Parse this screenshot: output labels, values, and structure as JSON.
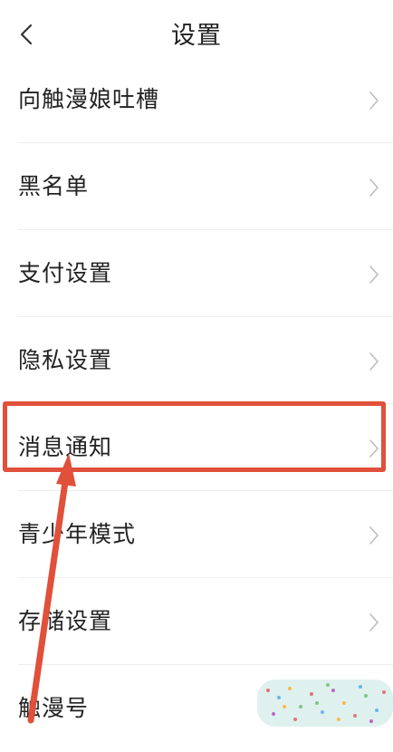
{
  "header": {
    "title": "设置"
  },
  "settings": {
    "items": [
      {
        "label": "向触漫娘吐槽"
      },
      {
        "label": "黑名单"
      },
      {
        "label": "支付设置"
      },
      {
        "label": "隐私设置"
      },
      {
        "label": "消息通知"
      },
      {
        "label": "青少年模式"
      },
      {
        "label": "存储设置"
      },
      {
        "label": "触漫号"
      }
    ]
  },
  "colors": {
    "annotation": "#e0503a",
    "divider": "#ededed",
    "text": "#222222",
    "chevron": "#bdbdbd"
  },
  "icons": {
    "back": "chevron-left-icon",
    "row": "chevron-right-icon"
  }
}
